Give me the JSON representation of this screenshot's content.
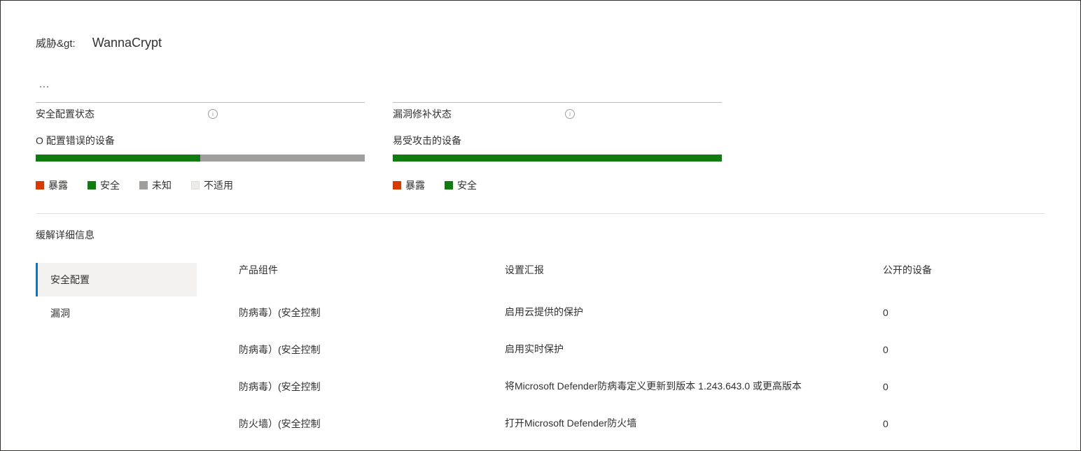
{
  "breadcrumb": {
    "label": "威胁&gt:",
    "value": "WannaCrypt"
  },
  "status": {
    "left": {
      "menu": "…",
      "title": "安全配置状态",
      "count_prefix": "O",
      "count_label": "配置错误的设备",
      "segments": [
        {
          "class": "seg-green",
          "width": "50%"
        },
        {
          "class": "seg-gray",
          "width": "50%"
        }
      ],
      "legend": [
        {
          "swatch": "sw-orange",
          "label": "暴露"
        },
        {
          "swatch": "sw-green",
          "label": "安全"
        },
        {
          "swatch": "sw-gray",
          "label": "未知"
        },
        {
          "swatch": "sw-light",
          "label": "不适用"
        }
      ]
    },
    "right": {
      "title": "漏洞修补状态",
      "count_label": "易受攻击的设备",
      "segments": [
        {
          "class": "seg-green",
          "width": "100%"
        }
      ],
      "legend": [
        {
          "swatch": "sw-orange",
          "label": "暴露"
        },
        {
          "swatch": "sw-green",
          "label": "安全"
        }
      ]
    }
  },
  "mitigation": {
    "section_title": "缓解详细信息",
    "tabs": [
      {
        "label": "安全配置",
        "active": true
      },
      {
        "label": "漏洞",
        "active": false
      }
    ],
    "columns": {
      "c1": "产品组件",
      "c2": "设置汇报",
      "c3": "公开的设备"
    },
    "rows": [
      {
        "c1": "防病毒）(安全控制",
        "c2": "启用云提供的保护",
        "c3": "0"
      },
      {
        "c1": "防病毒）(安全控制",
        "c2": "启用实时保护",
        "c3": "0"
      },
      {
        "c1": "防病毒）(安全控制",
        "c2": "将Microsoft Defender防病毒定义更新到版本 1.243.643.0 或更高版本",
        "c3": "0"
      },
      {
        "c1": "防火墙）(安全控制",
        "c2": "打开Microsoft Defender防火墙",
        "c3": "0"
      }
    ]
  }
}
